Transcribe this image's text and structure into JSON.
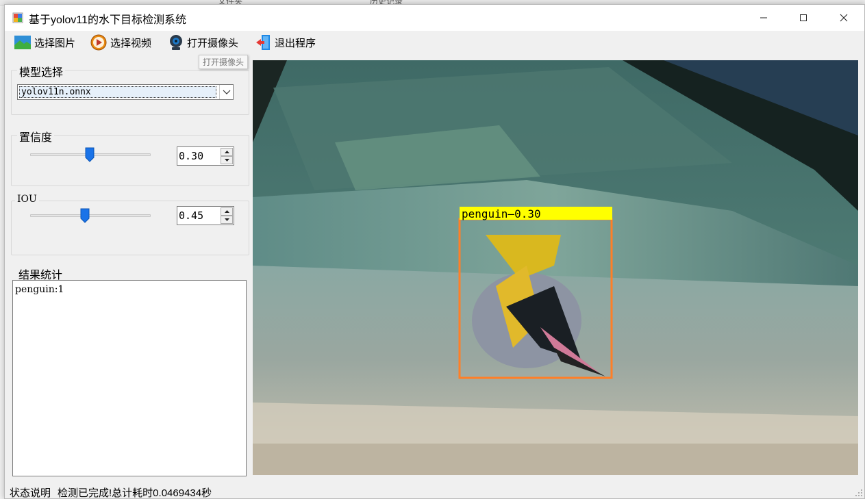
{
  "window": {
    "title": "基于yolov11的水下目标检测系统"
  },
  "background_app": {
    "fragment_1": "文件夹",
    "fragment_2": "历史记录"
  },
  "toolbar": {
    "items": [
      {
        "label": "选择图片",
        "icon": "image-icon"
      },
      {
        "label": "选择视频",
        "icon": "play-icon"
      },
      {
        "label": "打开摄像头",
        "icon": "webcam-icon"
      },
      {
        "label": "退出程序",
        "icon": "exit-door-icon"
      }
    ],
    "tooltip": "打开摄像头"
  },
  "model_group": {
    "title": "模型选择",
    "selected_model": "yolov11n.onnx"
  },
  "confidence_group": {
    "title": "置信度",
    "value": "0.30",
    "slider_level": 0.3
  },
  "iou_group": {
    "title": "IOU",
    "value": "0.45",
    "slider_level": 0.45
  },
  "results_group": {
    "title": "结果统计",
    "text": "penguin:1"
  },
  "detection": {
    "label": "penguin—0.30",
    "box_color": "#ff7f27",
    "label_bg": "#ffff00"
  },
  "statusbar": {
    "label": "状态说明",
    "message": "检测已完成!总计耗时0.0469434秒"
  }
}
